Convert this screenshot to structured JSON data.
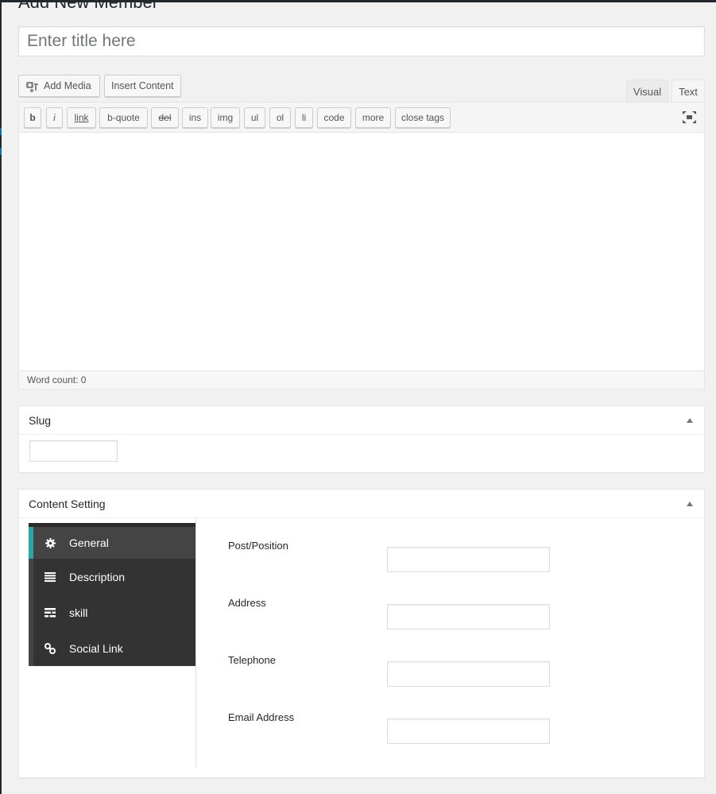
{
  "page": {
    "title": "Add New Member"
  },
  "title_field": {
    "placeholder": "Enter title here",
    "value": ""
  },
  "media_buttons": {
    "add_media": "Add Media",
    "insert_content": "Insert Content"
  },
  "editor_tabs": {
    "visual": "Visual",
    "text": "Text",
    "active": "Text"
  },
  "quicktags": [
    "b",
    "i",
    "link",
    "b-quote",
    "del",
    "ins",
    "img",
    "ul",
    "ol",
    "li",
    "code",
    "more",
    "close tags"
  ],
  "editor": {
    "content": "",
    "word_count": "Word count: 0"
  },
  "slug_box": {
    "title": "Slug",
    "value": ""
  },
  "content_setting": {
    "title": "Content Setting",
    "nav": [
      {
        "label": "General",
        "icon": "gear-icon",
        "active": true
      },
      {
        "label": "Description",
        "icon": "align-justify-icon",
        "active": false
      },
      {
        "label": "skill",
        "icon": "list-icon",
        "active": false
      },
      {
        "label": "Social Link",
        "icon": "link-icon",
        "active": false
      }
    ],
    "fields": [
      {
        "label": "Post/Position",
        "value": ""
      },
      {
        "label": "Address",
        "value": ""
      },
      {
        "label": "Telephone",
        "value": ""
      },
      {
        "label": "Email Address",
        "value": ""
      }
    ]
  },
  "colors": {
    "accent": "#2aa5a5",
    "nav_bg": "#333333",
    "nav_active_bg": "#444444",
    "admin_bar": "#23282d",
    "admin_accent": "#0073aa"
  }
}
